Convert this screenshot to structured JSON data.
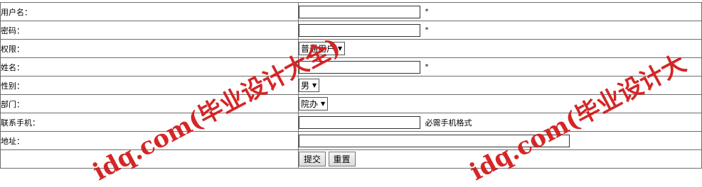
{
  "form": {
    "username": {
      "label": "用户名：",
      "value": "",
      "required": "*"
    },
    "password": {
      "label": "密码：",
      "value": "",
      "required": "*"
    },
    "permission": {
      "label": "权限：",
      "selected": "普通用户"
    },
    "name": {
      "label": "姓名：",
      "value": "",
      "required": "*"
    },
    "gender": {
      "label": "性别：",
      "selected": "男"
    },
    "department": {
      "label": "部门：",
      "selected": "院办"
    },
    "phone": {
      "label": "联系手机：",
      "value": "",
      "hint": "必需手机格式"
    },
    "address": {
      "label": "地址：",
      "value": ""
    },
    "submit_label": "提交",
    "reset_label": "重置"
  },
  "watermark": {
    "left": "idq.com(毕业设计大全)",
    "right": "idq.com(毕业设计大"
  }
}
